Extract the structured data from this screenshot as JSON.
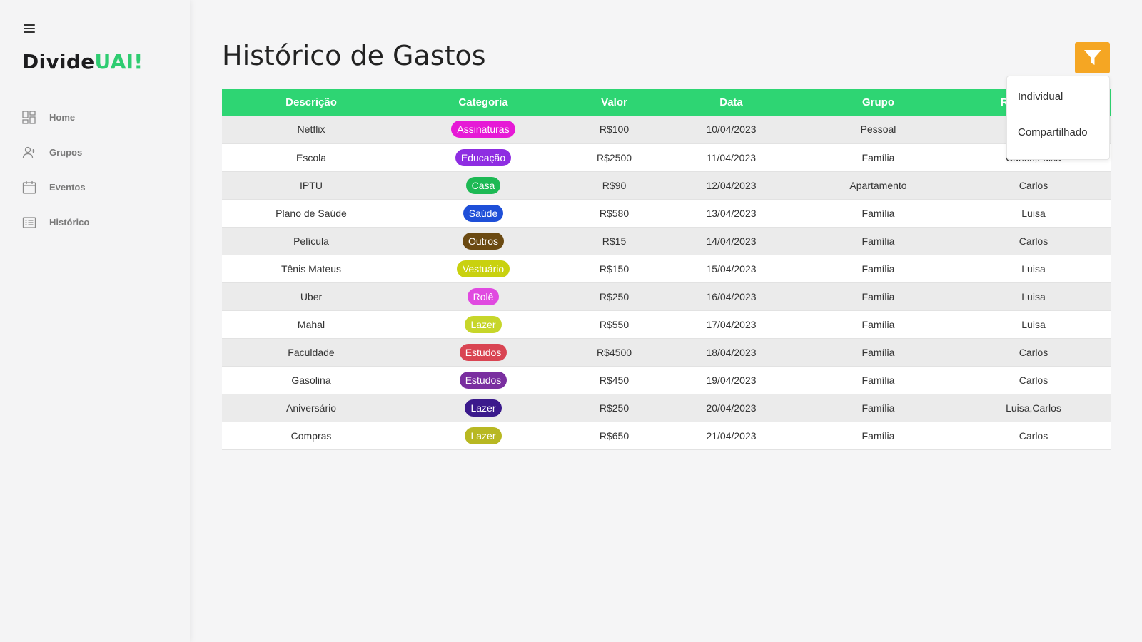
{
  "brand": {
    "part1": "Divide",
    "part2": "UAI!"
  },
  "nav": [
    {
      "label": "Home",
      "icon": "grid-icon"
    },
    {
      "label": "Grupos",
      "icon": "add-user-icon"
    },
    {
      "label": "Eventos",
      "icon": "calendar-icon"
    },
    {
      "label": "Histórico",
      "icon": "list-icon"
    }
  ],
  "page": {
    "title": "Histórico de Gastos"
  },
  "filter": {
    "icon": "filter-icon",
    "color": "#f5a623",
    "options": [
      "Individual",
      "Compartilhado"
    ]
  },
  "table": {
    "header_color": "#2ed573",
    "columns": [
      "Descrição",
      "Categoria",
      "Valor",
      "Data",
      "Grupo",
      "Responsável"
    ],
    "rows": [
      {
        "descricao": "Netflix",
        "categoria": "Assinaturas",
        "cat_color": "#e619d6",
        "valor": "R$100",
        "data": "10/04/2023",
        "grupo": "Pessoal",
        "responsavel": ""
      },
      {
        "descricao": "Escola",
        "categoria": "Educação",
        "cat_color": "#8e2de2",
        "valor": "R$2500",
        "data": "11/04/2023",
        "grupo": "Família",
        "responsavel": "Carlos,Luisa"
      },
      {
        "descricao": "IPTU",
        "categoria": "Casa",
        "cat_color": "#1db954",
        "valor": "R$90",
        "data": "12/04/2023",
        "grupo": "Apartamento",
        "responsavel": "Carlos"
      },
      {
        "descricao": "Plano de Saúde",
        "categoria": "Saúde",
        "cat_color": "#1e4fd8",
        "valor": "R$580",
        "data": "13/04/2023",
        "grupo": "Família",
        "responsavel": "Luisa"
      },
      {
        "descricao": "Película",
        "categoria": "Outros",
        "cat_color": "#6b4a12",
        "valor": "R$15",
        "data": "14/04/2023",
        "grupo": "Família",
        "responsavel": "Carlos"
      },
      {
        "descricao": "Tênis Mateus",
        "categoria": "Vestuário",
        "cat_color": "#c9d10f",
        "valor": "R$150",
        "data": "15/04/2023",
        "grupo": "Família",
        "responsavel": "Luisa"
      },
      {
        "descricao": "Uber",
        "categoria": "Rolê",
        "cat_color": "#e04ae0",
        "valor": "R$250",
        "data": "16/04/2023",
        "grupo": "Família",
        "responsavel": "Luisa"
      },
      {
        "descricao": "Mahal",
        "categoria": "Lazer",
        "cat_color": "#c7d62a",
        "valor": "R$550",
        "data": "17/04/2023",
        "grupo": "Família",
        "responsavel": "Luisa"
      },
      {
        "descricao": "Faculdade",
        "categoria": "Estudos",
        "cat_color": "#d94452",
        "valor": "R$4500",
        "data": "18/04/2023",
        "grupo": "Família",
        "responsavel": "Carlos"
      },
      {
        "descricao": "Gasolina",
        "categoria": "Estudos",
        "cat_color": "#7a2fa0",
        "valor": "R$450",
        "data": "19/04/2023",
        "grupo": "Família",
        "responsavel": "Carlos"
      },
      {
        "descricao": "Aniversário",
        "categoria": "Lazer",
        "cat_color": "#3b1a8c",
        "valor": "R$250",
        "data": "20/04/2023",
        "grupo": "Família",
        "responsavel": "Luisa,Carlos"
      },
      {
        "descricao": "Compras",
        "categoria": "Lazer",
        "cat_color": "#b8b822",
        "valor": "R$650",
        "data": "21/04/2023",
        "grupo": "Família",
        "responsavel": "Carlos"
      }
    ]
  }
}
